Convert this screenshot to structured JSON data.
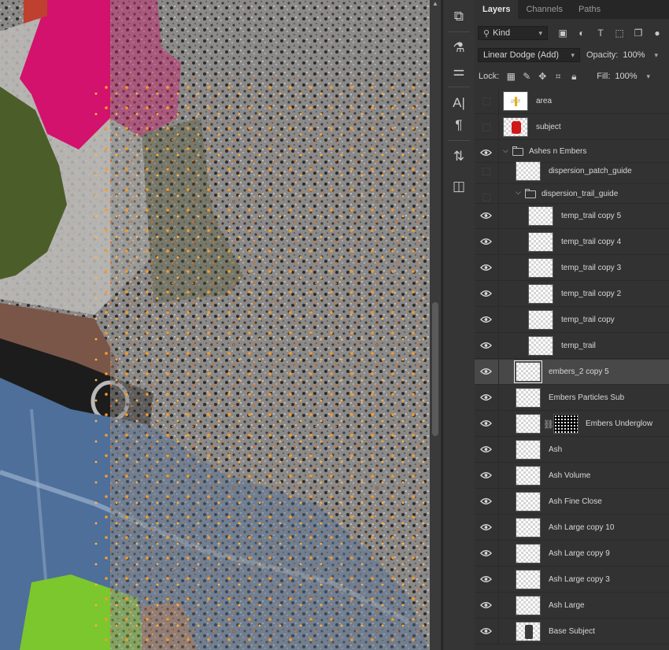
{
  "tabs": [
    "Layers",
    "Channels",
    "Paths"
  ],
  "filter": {
    "label": "Kind"
  },
  "blend_mode": "Linear Dodge (Add)",
  "opacity": {
    "label": "Opacity:",
    "value": "100%"
  },
  "lock": {
    "label": "Lock:"
  },
  "fill": {
    "label": "Fill:",
    "value": "100%"
  },
  "layers": [
    {
      "name": "area",
      "visible": false
    },
    {
      "name": "subject",
      "visible": false
    },
    {
      "name": "Ashes n Embers",
      "visible": true,
      "group": true
    },
    {
      "name": "dispersion_patch_guide",
      "visible": false
    },
    {
      "name": "dispersion_trail_guide",
      "visible": false,
      "group": true
    },
    {
      "name": "temp_trail copy 5",
      "visible": true
    },
    {
      "name": "temp_trail copy 4",
      "visible": true
    },
    {
      "name": "temp_trail copy 3",
      "visible": true
    },
    {
      "name": "temp_trail copy 2",
      "visible": true
    },
    {
      "name": "temp_trail copy",
      "visible": true
    },
    {
      "name": "temp_trail",
      "visible": true
    },
    {
      "name": "embers_2 copy 5",
      "visible": true,
      "selected": true
    },
    {
      "name": "Embers Particles Sub",
      "visible": true
    },
    {
      "name": "Embers Underglow",
      "visible": true,
      "mask": true
    },
    {
      "name": "Ash",
      "visible": true
    },
    {
      "name": "Ash Volume",
      "visible": true
    },
    {
      "name": "Ash Fine Close",
      "visible": true
    },
    {
      "name": "Ash Large copy 10",
      "visible": true
    },
    {
      "name": "Ash Large copy 9",
      "visible": true
    },
    {
      "name": "Ash Large copy 3",
      "visible": true
    },
    {
      "name": "Ash Large",
      "visible": true
    },
    {
      "name": "Base Subject",
      "visible": true
    }
  ],
  "colors": {
    "panel": "#323232",
    "selected_row": "#484848",
    "ember": "#ff8a1e",
    "magenta": "#e0117a",
    "denim": "#4d6f99"
  }
}
